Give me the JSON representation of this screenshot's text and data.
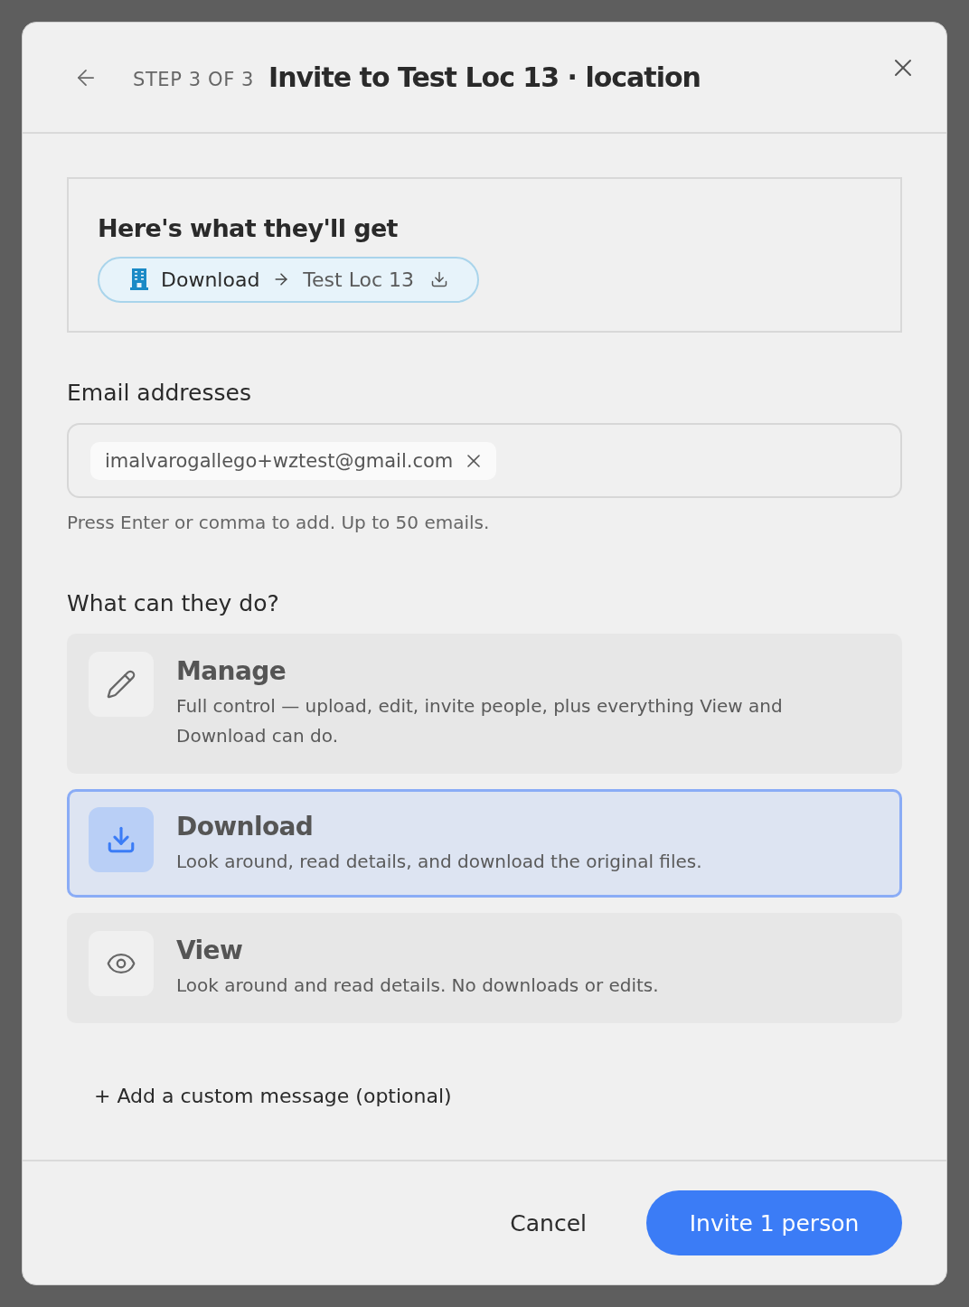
{
  "header": {
    "step": "STEP 3 OF 3",
    "title": "Invite to Test Loc 13 · location"
  },
  "summary": {
    "heading": "Here's what they'll get",
    "chip": {
      "role": "Download",
      "target": "Test Loc 13"
    }
  },
  "emails": {
    "label": "Email addresses",
    "tags": [
      {
        "value": "imalvarogallego+wztest@gmail.com"
      }
    ],
    "hint": "Press Enter or comma to add. Up to 50 emails."
  },
  "permissions": {
    "label": "What can they do?",
    "options": [
      {
        "kind": "manage",
        "title": "Manage",
        "description": "Full control — upload, edit, invite people, plus everything View and Download can do.",
        "selected": false
      },
      {
        "kind": "download",
        "title": "Download",
        "description": "Look around, read details, and download the original files.",
        "selected": true
      },
      {
        "kind": "view",
        "title": "View",
        "description": "Look around and read details. No downloads or edits.",
        "selected": false
      }
    ]
  },
  "custom_message": "+ Add a custom message (optional)",
  "footer": {
    "cancel": "Cancel",
    "submit": "Invite 1 person"
  }
}
